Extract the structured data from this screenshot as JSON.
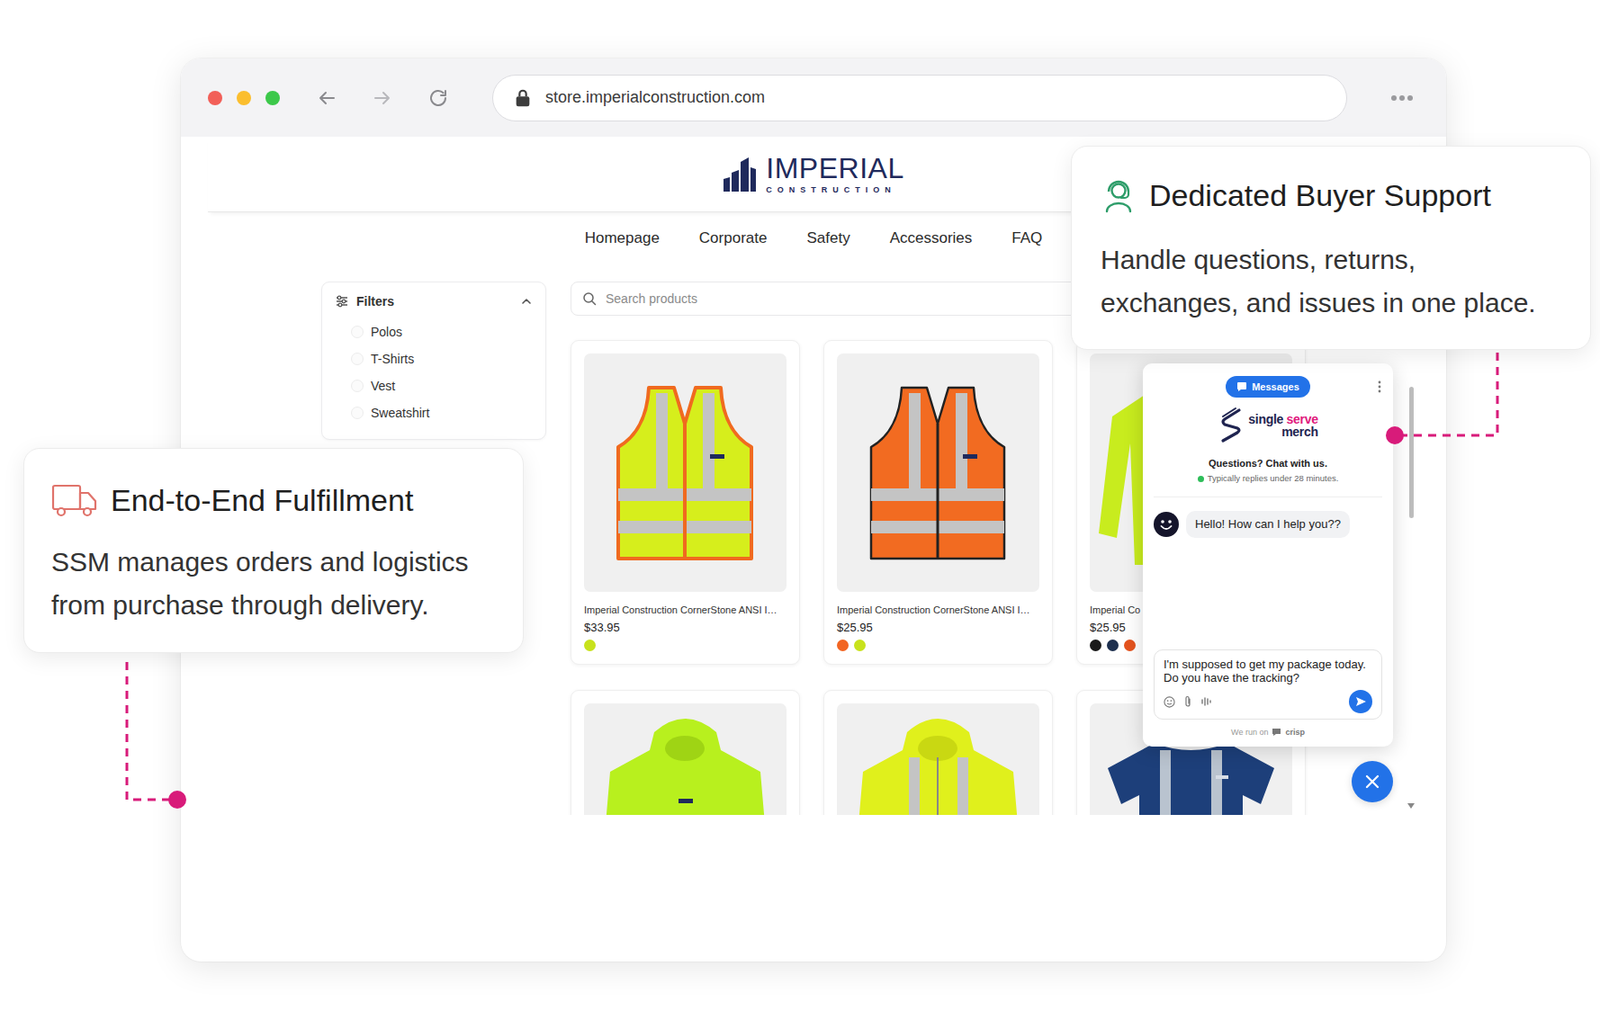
{
  "browser": {
    "url": "store.imperialconstruction.com"
  },
  "logo": {
    "name": "IMPERIAL",
    "tagline": "CONSTRUCTION"
  },
  "nav": [
    {
      "label": "Homepage"
    },
    {
      "label": "Corporate"
    },
    {
      "label": "Safety"
    },
    {
      "label": "Accessories"
    },
    {
      "label": "FAQ"
    }
  ],
  "filters": {
    "title": "Filters",
    "expanded": true,
    "items": [
      {
        "label": "Polos",
        "checked": false
      },
      {
        "label": "T-Shirts",
        "checked": false
      },
      {
        "label": "Vest",
        "checked": false
      },
      {
        "label": "Sweatshirt",
        "checked": false
      }
    ]
  },
  "search": {
    "placeholder": "Search products"
  },
  "products": [
    {
      "name": "Imperial Construction CornerStone ANSI I…",
      "price": "$33.95",
      "swatches": [
        {
          "color": "#c8e21c"
        }
      ]
    },
    {
      "name": "Imperial Construction CornerStone ANSI I…",
      "price": "$25.95",
      "swatches": [
        {
          "color": "#f26522"
        },
        {
          "color": "#c8e21c"
        }
      ]
    },
    {
      "name": "Imperial Co",
      "price": "$25.95",
      "swatches": [
        {
          "color": "#1a1a1a"
        },
        {
          "color": "#1d2f4e"
        },
        {
          "color": "#e4531e"
        }
      ]
    }
  ],
  "chat": {
    "tab": "Messages",
    "brand": {
      "first": "single",
      "accent": "serve",
      "second": "merch"
    },
    "heading": "Questions? Chat with us.",
    "status": "Typically replies under 28 minutes.",
    "online": true,
    "messages": [
      {
        "text": "Hello! How can I help you??"
      }
    ],
    "draft": "I'm supposed to get my package today. Do you have the tracking?",
    "footer": {
      "prefix": "We run on",
      "brand": "crisp"
    }
  },
  "callouts": [
    {
      "title": "Dedicated Buyer Support",
      "lines": [
        "Handle questions, returns,",
        "exchanges, and issues in one place."
      ]
    },
    {
      "title": "End-to-End Fulfillment",
      "lines": [
        "SSM manages orders and logistics",
        "from purchase through delivery."
      ]
    }
  ]
}
